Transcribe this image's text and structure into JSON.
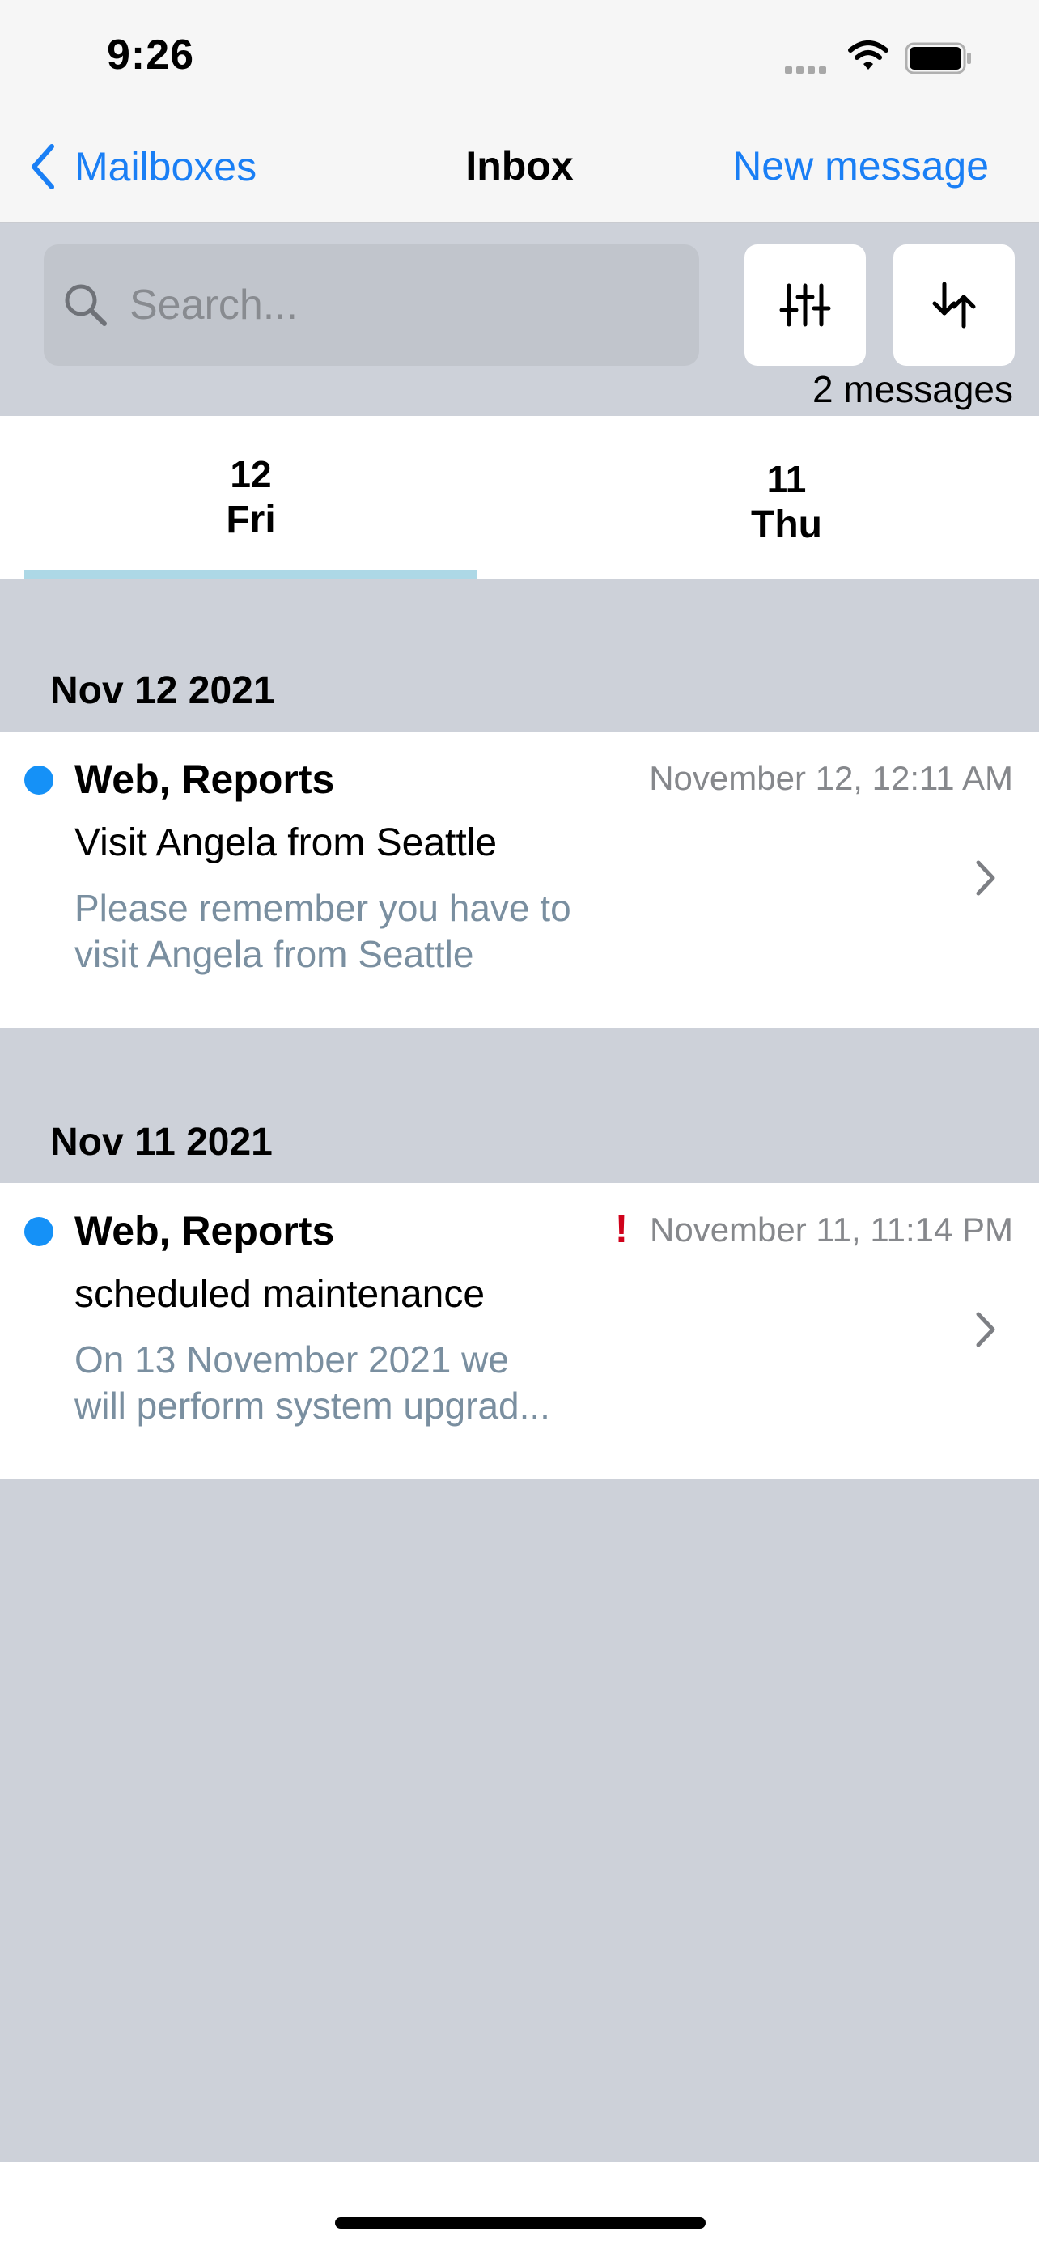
{
  "status_bar": {
    "time": "9:26"
  },
  "nav": {
    "back_label": "Mailboxes",
    "title": "Inbox",
    "new_message_label": "New message"
  },
  "toolbar": {
    "search_placeholder": "Search...",
    "message_count": "2 messages"
  },
  "day_tabs": [
    {
      "day": "12",
      "weekday": "Fri",
      "selected": true
    },
    {
      "day": "11",
      "weekday": "Thu",
      "selected": false
    }
  ],
  "sections": [
    {
      "header": "Nov 12 2021",
      "messages": [
        {
          "sender": "Web, Reports",
          "timestamp": "November 12, 12:11 AM",
          "subject": "Visit Angela from Seattle",
          "preview_line1": "Please remember you have to",
          "preview_line2": "visit Angela from Seattle",
          "unread": true,
          "high_priority": false
        }
      ]
    },
    {
      "header": "Nov 11 2021",
      "messages": [
        {
          "sender": "Web, Reports",
          "timestamp": "November 11, 11:14 PM",
          "subject": "scheduled maintenance",
          "preview_line1": "On 13 November 2021 we",
          "preview_line2": "will perform system upgrad...",
          "unread": true,
          "high_priority": true,
          "priority_mark": "!"
        }
      ]
    }
  ],
  "colors": {
    "accent": "#1a7ff5",
    "unread_dot": "#1591f7",
    "priority": "#d0021b",
    "list_background": "#cdd1d9",
    "tab_underline": "#add8e6"
  },
  "icons": [
    "chevron-left-icon",
    "search-icon",
    "sliders-icon",
    "sort-icon",
    "chevron-right-icon",
    "wifi-icon",
    "battery-icon",
    "cellular-signal-icon",
    "priority-icon"
  ]
}
